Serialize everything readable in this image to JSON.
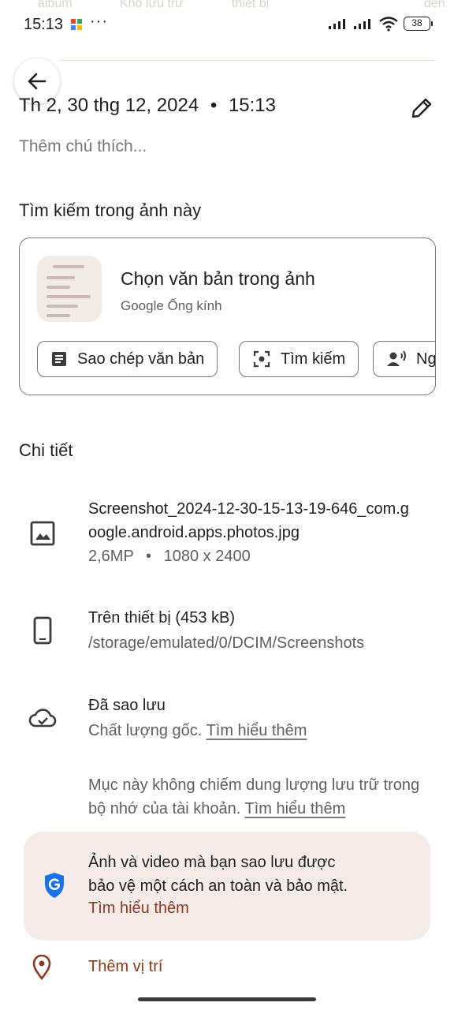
{
  "ghost_tabs": [
    "album",
    "Kho lưu trữ",
    "thiết bị",
    "đến"
  ],
  "status_bar": {
    "time": "15:13",
    "more": "···",
    "battery": "38"
  },
  "header": {
    "date": "Th 2, 30 thg 12, 2024",
    "separator": "•",
    "time": "15:13",
    "caption_placeholder": "Thêm chú thích..."
  },
  "lens_section": {
    "heading": "Tìm kiếm trong ảnh này",
    "title": "Chọn văn bản trong ảnh",
    "subtitle": "Google Ống kính",
    "chips": [
      {
        "label": "Sao chép văn bản",
        "icon": "document-icon"
      },
      {
        "label": "Tìm kiếm",
        "icon": "lens-search-icon"
      },
      {
        "label": "Ng",
        "icon": "listen-icon"
      }
    ]
  },
  "details": {
    "heading": "Chi tiết",
    "file": {
      "name_line1": "Screenshot_2024-12-30-15-13-19-646_com.g",
      "name_line2": "oogle.android.apps.photos.jpg",
      "megapixels": "2,6MP",
      "separator": "•",
      "resolution": "1080 x 2400"
    },
    "storage": {
      "title": "Trên thiết bị (453 kB)",
      "path": "/storage/emulated/0/DCIM/Screenshots"
    },
    "backup": {
      "title": "Đã sao lưu",
      "quality": "Chất lượng gốc.",
      "learn_more": "Tìm hiểu thêm",
      "note_line1": "Mục này không chiếm dung lượng lưu trữ trong",
      "note_line2": "bộ nhớ của tài khoản.",
      "note_learn_more": "Tìm hiểu thêm"
    },
    "protection": {
      "line1": "Ảnh và video mà bạn sao lưu được",
      "line2": "bảo vệ một cách an toàn và bảo mật.",
      "learn_more": "Tìm hiểu thêm"
    },
    "location": {
      "label": "Thêm vị trí"
    }
  },
  "colors": {
    "accent": "#8c3a1e",
    "shield": "#1a73e8",
    "card_bg": "#f5ecea",
    "outline": "#79747e"
  }
}
